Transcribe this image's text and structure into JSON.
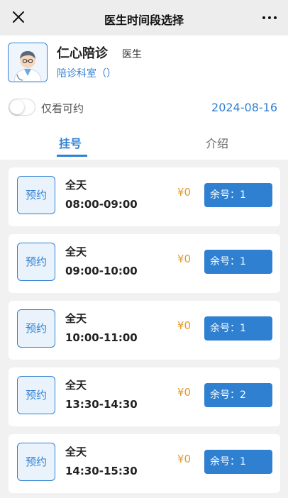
{
  "nav": {
    "title": "医生时间段选择"
  },
  "doctor": {
    "name": "仁心陪诊",
    "role": "医生",
    "department": "陪诊科室（）"
  },
  "filter": {
    "toggle_label": "仅看可约",
    "date": "2024-08-16"
  },
  "tabs": [
    {
      "label": "挂号"
    },
    {
      "label": "介绍"
    }
  ],
  "slots": [
    {
      "book": "预约",
      "day": "全天",
      "time": "08:00-09:00",
      "price": "¥0",
      "remaining": "余号：1"
    },
    {
      "book": "预约",
      "day": "全天",
      "time": "09:00-10:00",
      "price": "¥0",
      "remaining": "余号：1"
    },
    {
      "book": "预约",
      "day": "全天",
      "time": "10:00-11:00",
      "price": "¥0",
      "remaining": "余号：1"
    },
    {
      "book": "预约",
      "day": "全天",
      "time": "13:30-14:30",
      "price": "¥0",
      "remaining": "余号：2"
    },
    {
      "book": "预约",
      "day": "全天",
      "time": "14:30-15:30",
      "price": "¥0",
      "remaining": "余号：1"
    }
  ],
  "icons": {
    "close": "close-icon",
    "more": "more-icon",
    "avatar": "doctor-avatar"
  },
  "colors": {
    "accent": "#2f80d1",
    "price": "#e59a2b"
  }
}
